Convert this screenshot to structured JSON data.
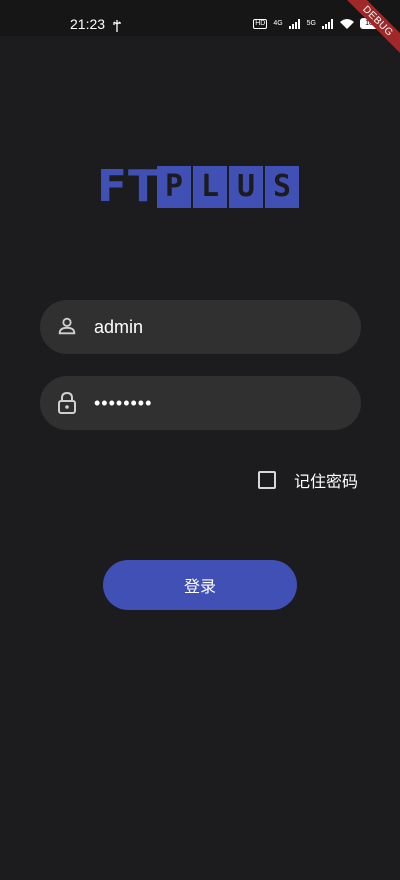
{
  "status_bar": {
    "time": "21:23",
    "network": "4G",
    "network2": "5G",
    "hd": "HD",
    "battery": "100"
  },
  "debug_banner": "DEBUG",
  "logo": {
    "ft": "FT",
    "plus": [
      "P",
      "L",
      "U",
      "S"
    ]
  },
  "form": {
    "username_value": "admin",
    "password_value": "••••••••",
    "remember_label": "记住密码",
    "remember_checked": false
  },
  "login_label": "登录",
  "colors": {
    "background": "#1c1c1e",
    "field": "#303030",
    "accent": "#4050b5",
    "debug": "#a02828"
  },
  "icons": {
    "username": "person-icon",
    "password": "lock-icon"
  }
}
